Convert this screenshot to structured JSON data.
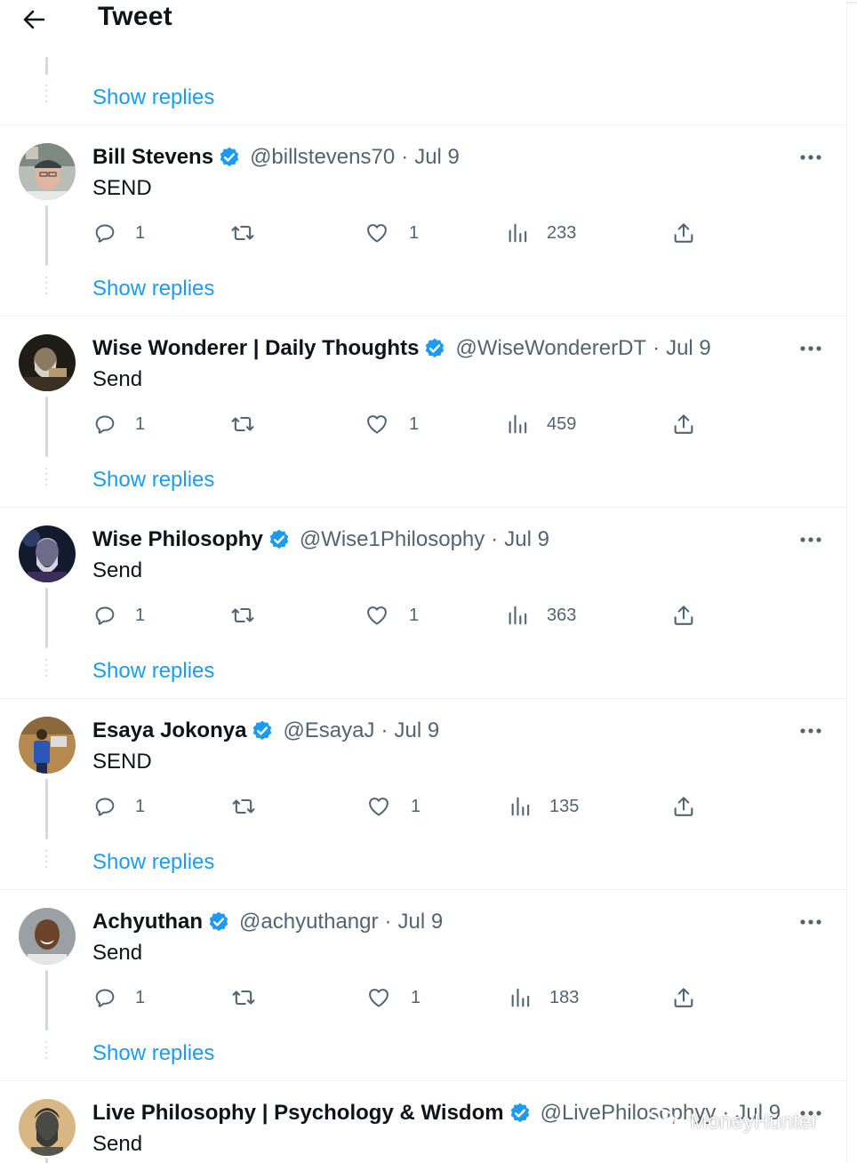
{
  "header": {
    "title": "Tweet"
  },
  "show_replies_label": "Show replies",
  "replies": [
    {
      "name": "Bill Stevens",
      "handle": "@billstevens70",
      "separator": "·",
      "date": "Jul 9",
      "text": "SEND",
      "reply_count": "1",
      "like_count": "1",
      "view_count": "233"
    },
    {
      "name": "Wise Wonderer | Daily Thoughts",
      "handle": "@WiseWondererDT",
      "separator": "·",
      "date": "Jul 9",
      "text": "Send",
      "reply_count": "1",
      "like_count": "1",
      "view_count": "459"
    },
    {
      "name": "Wise Philosophy",
      "handle": "@Wise1Philosophy",
      "separator": "·",
      "date": "Jul 9",
      "text": "Send",
      "reply_count": "1",
      "like_count": "1",
      "view_count": "363"
    },
    {
      "name": "Esaya Jokonya",
      "handle": "@EsayaJ",
      "separator": "·",
      "date": "Jul 9",
      "text": "SEND",
      "reply_count": "1",
      "like_count": "1",
      "view_count": "135"
    },
    {
      "name": "Achyuthan",
      "handle": "@achyuthangr",
      "separator": "·",
      "date": "Jul 9",
      "text": "Send",
      "reply_count": "1",
      "like_count": "1",
      "view_count": "183"
    },
    {
      "name": "Live Philosophy | Psychology & Wisdom",
      "handle": "@LivePhilosophyy",
      "separator": "·",
      "date": "Jul 9",
      "text": "Send"
    }
  ],
  "watermark": {
    "text": "MoneyHunter"
  },
  "colors": {
    "accent": "#1d9bf0",
    "secondary_text": "#536471",
    "primary_text": "#0f1419",
    "verified": "#1d9bf0",
    "thread_line": "#cfd9de"
  },
  "icons": [
    "back-arrow-icon",
    "verified-badge-icon",
    "more-options-icon",
    "reply-icon",
    "retweet-icon",
    "like-icon",
    "views-icon",
    "share-icon",
    "wechat-icon"
  ]
}
